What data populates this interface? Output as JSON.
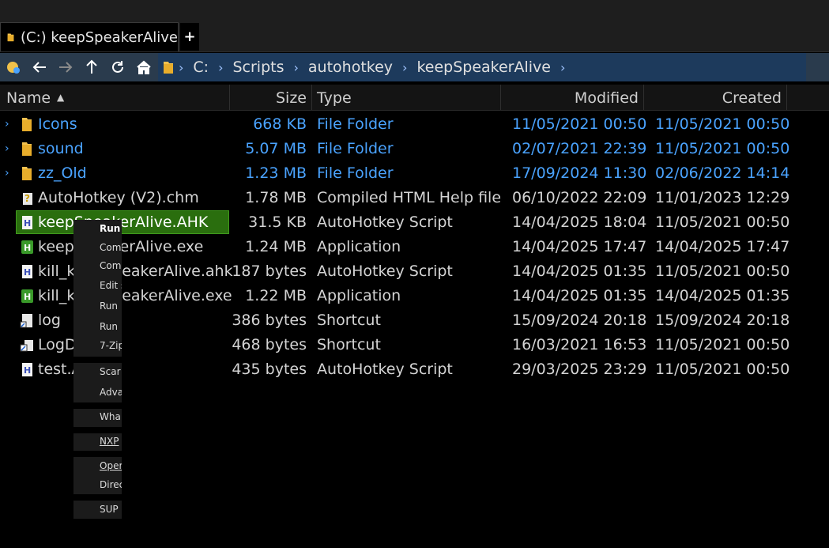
{
  "tab": {
    "label": "(C:) keepSpeakerAlive",
    "new_tab": "+"
  },
  "address": {
    "crumbs": [
      "C:",
      "Scripts",
      "autohotkey",
      "keepSpeakerAlive"
    ]
  },
  "columns": {
    "name": "Name",
    "size": "Size",
    "type": "Type",
    "modified": "Modified",
    "created": "Created"
  },
  "rows": [
    {
      "kind": "folder",
      "name": "Icons",
      "size": "668 KB",
      "type": "File Folder",
      "modified": "11/05/2021  00:50",
      "created": "11/05/2021  00:50",
      "icon": "folder-icon"
    },
    {
      "kind": "folder",
      "name": "sound",
      "size": "5.07 MB",
      "type": "File Folder",
      "modified": "02/07/2021  22:39",
      "created": "11/05/2021  00:50",
      "icon": "folder-icon"
    },
    {
      "kind": "folder",
      "name": "zz_Old",
      "size": "1.23 MB",
      "type": "File Folder",
      "modified": "17/09/2024  11:30",
      "created": "02/06/2022  14:14",
      "icon": "folder-icon"
    },
    {
      "kind": "file",
      "name": "AutoHotkey (V2).chm",
      "size": "1.78 MB",
      "type": "Compiled HTML Help file",
      "modified": "06/10/2022  22:09",
      "created": "11/01/2023  12:29",
      "icon": "help-file-icon"
    },
    {
      "kind": "file",
      "name": "keepSpeakerAlive.AHK",
      "size": "31.5 KB",
      "type": "AutoHotkey Script",
      "modified": "14/04/2025  18:04",
      "created": "11/05/2021  00:50",
      "icon": "ahk-script-icon",
      "selected": true
    },
    {
      "kind": "file",
      "name": "keepSpeakerAlive.exe",
      "size": "1.24 MB",
      "type": "Application",
      "modified": "14/04/2025  17:47",
      "created": "14/04/2025  17:47",
      "icon": "ahk-exe-icon"
    },
    {
      "kind": "file",
      "name": "kill_keepSpeakerAlive.ahk",
      "size": "187 bytes",
      "type": "AutoHotkey Script",
      "modified": "14/04/2025  01:35",
      "created": "11/05/2021  00:50",
      "icon": "ahk-script-icon"
    },
    {
      "kind": "file",
      "name": "kill_keepSpeakerAlive.exe",
      "size": "1.22 MB",
      "type": "Application",
      "modified": "14/04/2025  01:35",
      "created": "14/04/2025  01:35",
      "icon": "ahk-exe-icon"
    },
    {
      "kind": "file",
      "name": "log",
      "size": "386 bytes",
      "type": "Shortcut",
      "modified": "15/09/2024  20:18",
      "created": "15/09/2024  20:18",
      "icon": "shortcut-icon"
    },
    {
      "kind": "file",
      "name": "LogD",
      "size": "468 bytes",
      "type": "Shortcut",
      "modified": "16/03/2021  16:53",
      "created": "11/05/2021  00:50",
      "icon": "shortcut-icon"
    },
    {
      "kind": "file",
      "name": "test.A",
      "size": "435 bytes",
      "type": "AutoHotkey Script",
      "modified": "29/03/2025  23:29",
      "created": "11/05/2021  00:50",
      "icon": "ahk-script-icon"
    }
  ],
  "context_menu": {
    "groups": [
      [
        "Run",
        "Com",
        "Com",
        "Edit s",
        "Run",
        "Run",
        "7-Zip"
      ],
      [
        "Scar",
        "Adva"
      ],
      [
        "Wha"
      ],
      [
        "NXP"
      ],
      [
        "Oper",
        "Direc"
      ],
      [
        "SUP"
      ]
    ]
  }
}
